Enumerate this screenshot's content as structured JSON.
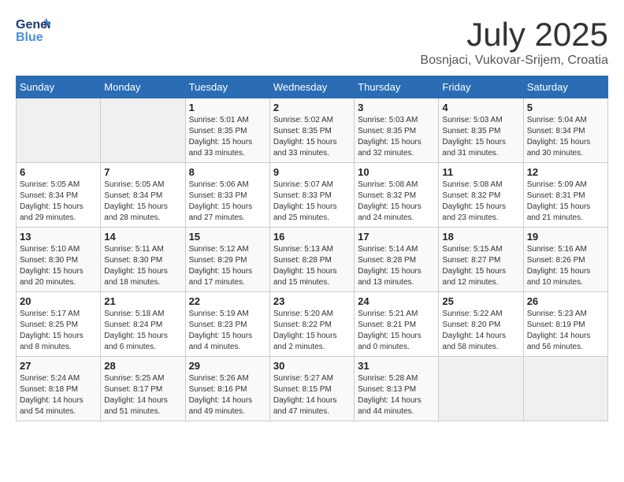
{
  "header": {
    "logo_general": "General",
    "logo_blue": "Blue",
    "month_title": "July 2025",
    "location": "Bosnjaci, Vukovar-Srijem, Croatia"
  },
  "weekdays": [
    "Sunday",
    "Monday",
    "Tuesday",
    "Wednesday",
    "Thursday",
    "Friday",
    "Saturday"
  ],
  "weeks": [
    [
      {
        "day": null,
        "info": null
      },
      {
        "day": null,
        "info": null
      },
      {
        "day": "1",
        "info": "Sunrise: 5:01 AM\nSunset: 8:35 PM\nDaylight: 15 hours\nand 33 minutes."
      },
      {
        "day": "2",
        "info": "Sunrise: 5:02 AM\nSunset: 8:35 PM\nDaylight: 15 hours\nand 33 minutes."
      },
      {
        "day": "3",
        "info": "Sunrise: 5:03 AM\nSunset: 8:35 PM\nDaylight: 15 hours\nand 32 minutes."
      },
      {
        "day": "4",
        "info": "Sunrise: 5:03 AM\nSunset: 8:35 PM\nDaylight: 15 hours\nand 31 minutes."
      },
      {
        "day": "5",
        "info": "Sunrise: 5:04 AM\nSunset: 8:34 PM\nDaylight: 15 hours\nand 30 minutes."
      }
    ],
    [
      {
        "day": "6",
        "info": "Sunrise: 5:05 AM\nSunset: 8:34 PM\nDaylight: 15 hours\nand 29 minutes."
      },
      {
        "day": "7",
        "info": "Sunrise: 5:05 AM\nSunset: 8:34 PM\nDaylight: 15 hours\nand 28 minutes."
      },
      {
        "day": "8",
        "info": "Sunrise: 5:06 AM\nSunset: 8:33 PM\nDaylight: 15 hours\nand 27 minutes."
      },
      {
        "day": "9",
        "info": "Sunrise: 5:07 AM\nSunset: 8:33 PM\nDaylight: 15 hours\nand 25 minutes."
      },
      {
        "day": "10",
        "info": "Sunrise: 5:08 AM\nSunset: 8:32 PM\nDaylight: 15 hours\nand 24 minutes."
      },
      {
        "day": "11",
        "info": "Sunrise: 5:08 AM\nSunset: 8:32 PM\nDaylight: 15 hours\nand 23 minutes."
      },
      {
        "day": "12",
        "info": "Sunrise: 5:09 AM\nSunset: 8:31 PM\nDaylight: 15 hours\nand 21 minutes."
      }
    ],
    [
      {
        "day": "13",
        "info": "Sunrise: 5:10 AM\nSunset: 8:30 PM\nDaylight: 15 hours\nand 20 minutes."
      },
      {
        "day": "14",
        "info": "Sunrise: 5:11 AM\nSunset: 8:30 PM\nDaylight: 15 hours\nand 18 minutes."
      },
      {
        "day": "15",
        "info": "Sunrise: 5:12 AM\nSunset: 8:29 PM\nDaylight: 15 hours\nand 17 minutes."
      },
      {
        "day": "16",
        "info": "Sunrise: 5:13 AM\nSunset: 8:28 PM\nDaylight: 15 hours\nand 15 minutes."
      },
      {
        "day": "17",
        "info": "Sunrise: 5:14 AM\nSunset: 8:28 PM\nDaylight: 15 hours\nand 13 minutes."
      },
      {
        "day": "18",
        "info": "Sunrise: 5:15 AM\nSunset: 8:27 PM\nDaylight: 15 hours\nand 12 minutes."
      },
      {
        "day": "19",
        "info": "Sunrise: 5:16 AM\nSunset: 8:26 PM\nDaylight: 15 hours\nand 10 minutes."
      }
    ],
    [
      {
        "day": "20",
        "info": "Sunrise: 5:17 AM\nSunset: 8:25 PM\nDaylight: 15 hours\nand 8 minutes."
      },
      {
        "day": "21",
        "info": "Sunrise: 5:18 AM\nSunset: 8:24 PM\nDaylight: 15 hours\nand 6 minutes."
      },
      {
        "day": "22",
        "info": "Sunrise: 5:19 AM\nSunset: 8:23 PM\nDaylight: 15 hours\nand 4 minutes."
      },
      {
        "day": "23",
        "info": "Sunrise: 5:20 AM\nSunset: 8:22 PM\nDaylight: 15 hours\nand 2 minutes."
      },
      {
        "day": "24",
        "info": "Sunrise: 5:21 AM\nSunset: 8:21 PM\nDaylight: 15 hours\nand 0 minutes."
      },
      {
        "day": "25",
        "info": "Sunrise: 5:22 AM\nSunset: 8:20 PM\nDaylight: 14 hours\nand 58 minutes."
      },
      {
        "day": "26",
        "info": "Sunrise: 5:23 AM\nSunset: 8:19 PM\nDaylight: 14 hours\nand 56 minutes."
      }
    ],
    [
      {
        "day": "27",
        "info": "Sunrise: 5:24 AM\nSunset: 8:18 PM\nDaylight: 14 hours\nand 54 minutes."
      },
      {
        "day": "28",
        "info": "Sunrise: 5:25 AM\nSunset: 8:17 PM\nDaylight: 14 hours\nand 51 minutes."
      },
      {
        "day": "29",
        "info": "Sunrise: 5:26 AM\nSunset: 8:16 PM\nDaylight: 14 hours\nand 49 minutes."
      },
      {
        "day": "30",
        "info": "Sunrise: 5:27 AM\nSunset: 8:15 PM\nDaylight: 14 hours\nand 47 minutes."
      },
      {
        "day": "31",
        "info": "Sunrise: 5:28 AM\nSunset: 8:13 PM\nDaylight: 14 hours\nand 44 minutes."
      },
      {
        "day": null,
        "info": null
      },
      {
        "day": null,
        "info": null
      }
    ]
  ]
}
